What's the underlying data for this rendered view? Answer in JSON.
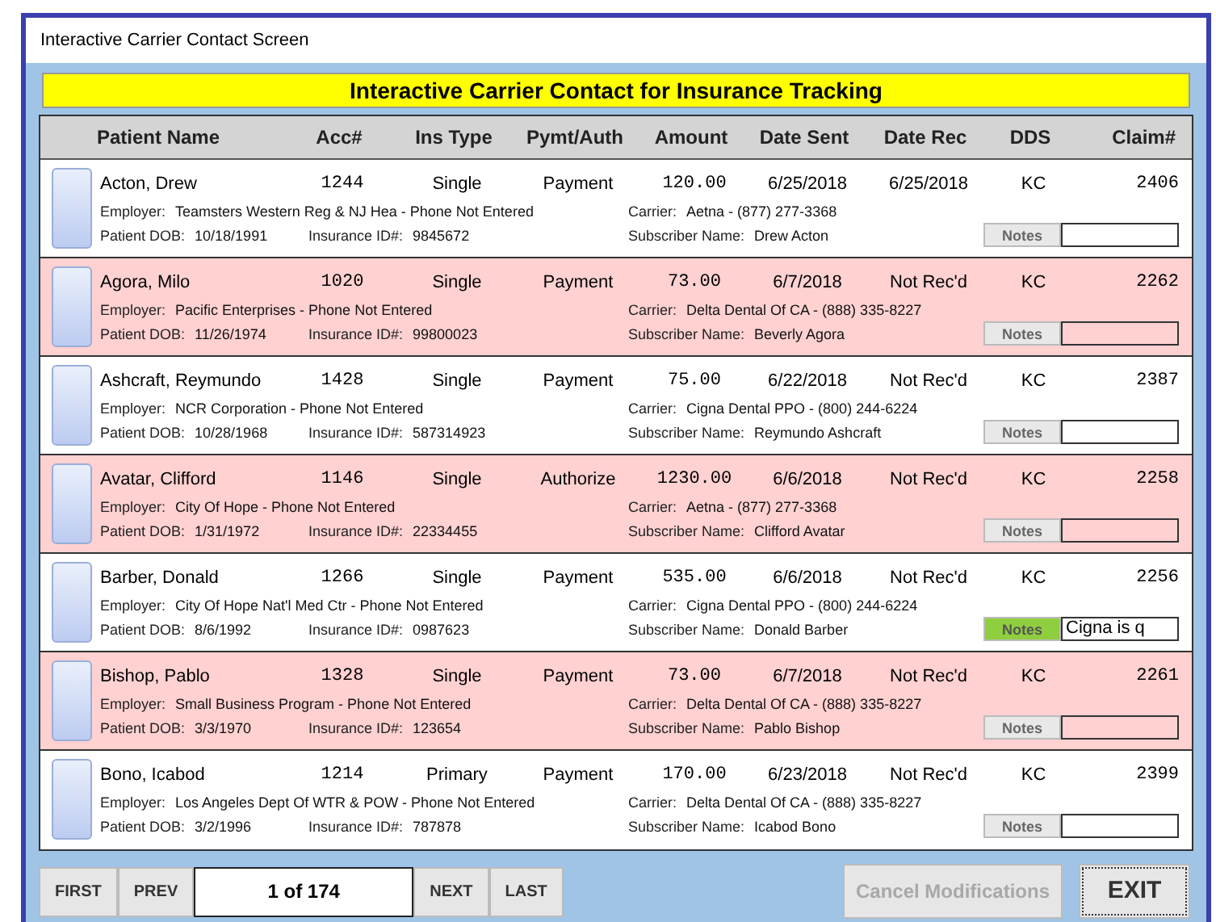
{
  "window": {
    "title": "Interactive Carrier Contact Screen"
  },
  "header": {
    "title": "Interactive Carrier Contact for Insurance Tracking"
  },
  "table": {
    "columns": [
      "Patient Name",
      "Acc#",
      "Ins Type",
      "Pymt/Auth",
      "Amount",
      "Date Sent",
      "Date Rec",
      "DDS",
      "Claim#"
    ],
    "rows": [
      {
        "flagged": false,
        "cells": [
          "Acton, Drew",
          "1244",
          "Single",
          "Payment",
          "120.00",
          "6/25/2018",
          "6/25/2018",
          "KC",
          "2406"
        ],
        "employer": {
          "label": "Employer:",
          "value": "Teamsters Western Reg & NJ Hea - Phone Not Entered"
        },
        "carrier": {
          "label": "Carrier:",
          "value": "Aetna - (877) 277-3368"
        },
        "dob": {
          "label": "Patient DOB:",
          "value": "10/18/1991"
        },
        "insurance_id": {
          "label": "Insurance ID#:",
          "value": "9845672"
        },
        "subscriber": {
          "label": "Subscriber Name:",
          "value": "Drew Acton"
        },
        "notes": {
          "label": "Notes",
          "active": false
        }
      },
      {
        "flagged": true,
        "cells": [
          "Agora, Milo",
          "1020",
          "Single",
          "Payment",
          "73.00",
          "6/7/2018",
          "Not Rec'd",
          "KC",
          "2262"
        ],
        "employer": {
          "label": "Employer:",
          "value": "Pacific Enterprises - Phone Not Entered"
        },
        "carrier": {
          "label": "Carrier:",
          "value": "Delta Dental Of CA - (888) 335-8227"
        },
        "dob": {
          "label": "Patient DOB:",
          "value": "11/26/1974"
        },
        "insurance_id": {
          "label": "Insurance ID#:",
          "value": "99800023"
        },
        "subscriber": {
          "label": "Subscriber Name:",
          "value": "Beverly Agora"
        },
        "notes": {
          "label": "Notes",
          "active": false
        }
      },
      {
        "flagged": false,
        "cells": [
          "Ashcraft, Reymundo",
          "1428",
          "Single",
          "Payment",
          "75.00",
          "6/22/2018",
          "Not Rec'd",
          "KC",
          "2387"
        ],
        "employer": {
          "label": "Employer:",
          "value": "NCR Corporation - Phone Not Entered"
        },
        "carrier": {
          "label": "Carrier:",
          "value": "Cigna Dental PPO - (800) 244-6224"
        },
        "dob": {
          "label": "Patient DOB:",
          "value": "10/28/1968"
        },
        "insurance_id": {
          "label": "Insurance ID#:",
          "value": "587314923"
        },
        "subscriber": {
          "label": "Subscriber Name:",
          "value": "Reymundo Ashcraft"
        },
        "notes": {
          "label": "Notes",
          "active": false
        }
      },
      {
        "flagged": true,
        "cells": [
          "Avatar, Clifford",
          "1146",
          "Single",
          "Authorize",
          "1230.00",
          "6/6/2018",
          "Not Rec'd",
          "KC",
          "2258"
        ],
        "employer": {
          "label": "Employer:",
          "value": "City Of Hope - Phone Not Entered"
        },
        "carrier": {
          "label": "Carrier:",
          "value": "Aetna - (877) 277-3368"
        },
        "dob": {
          "label": "Patient DOB:",
          "value": "1/31/1972"
        },
        "insurance_id": {
          "label": "Insurance ID#:",
          "value": "22334455"
        },
        "subscriber": {
          "label": "Subscriber Name:",
          "value": "Clifford Avatar"
        },
        "notes": {
          "label": "Notes",
          "active": false
        }
      },
      {
        "flagged": false,
        "cells": [
          "Barber, Donald",
          "1266",
          "Single",
          "Payment",
          "535.00",
          "6/6/2018",
          "Not Rec'd",
          "KC",
          "2256"
        ],
        "employer": {
          "label": "Employer:",
          "value": "City Of Hope Nat'l Med Ctr - Phone Not Entered"
        },
        "carrier": {
          "label": "Carrier:",
          "value": "Cigna Dental PPO - (800) 244-6224"
        },
        "dob": {
          "label": "Patient DOB:",
          "value": "8/6/1992"
        },
        "insurance_id": {
          "label": "Insurance ID#:",
          "value": "0987623"
        },
        "subscriber": {
          "label": "Subscriber Name:",
          "value": "Donald Barber"
        },
        "notes": {
          "label": "Notes",
          "active": true,
          "value": "Cigna is q"
        }
      },
      {
        "flagged": true,
        "cells": [
          "Bishop, Pablo",
          "1328",
          "Single",
          "Payment",
          "73.00",
          "6/7/2018",
          "Not Rec'd",
          "KC",
          "2261"
        ],
        "employer": {
          "label": "Employer:",
          "value": "Small Business Program - Phone Not Entered"
        },
        "carrier": {
          "label": "Carrier:",
          "value": "Delta Dental Of CA - (888) 335-8227"
        },
        "dob": {
          "label": "Patient DOB:",
          "value": "3/3/1970"
        },
        "insurance_id": {
          "label": "Insurance ID#:",
          "value": "123654"
        },
        "subscriber": {
          "label": "Subscriber Name:",
          "value": "Pablo Bishop"
        },
        "notes": {
          "label": "Notes",
          "active": false
        }
      },
      {
        "flagged": false,
        "cells": [
          "Bono, Icabod",
          "1214",
          "Primary",
          "Payment",
          "170.00",
          "6/23/2018",
          "Not Rec'd",
          "KC",
          "2399"
        ],
        "employer": {
          "label": "Employer:",
          "value": "Los Angeles Dept Of WTR & POW - Phone Not Entered"
        },
        "carrier": {
          "label": "Carrier:",
          "value": "Delta Dental Of CA - (888) 335-8227"
        },
        "dob": {
          "label": "Patient DOB:",
          "value": "3/2/1996"
        },
        "insurance_id": {
          "label": "Insurance ID#:",
          "value": "787878"
        },
        "subscriber": {
          "label": "Subscriber Name:",
          "value": "Icabod Bono"
        },
        "notes": {
          "label": "Notes",
          "active": false
        }
      }
    ]
  },
  "pager": {
    "before": [
      "FIRST",
      "PREV"
    ],
    "position": "1 of 174",
    "after": [
      "NEXT",
      "LAST"
    ]
  },
  "actions": [
    {
      "label": "Cancel Modifications",
      "disabled": true
    },
    {
      "label": "EXIT",
      "disabled": false
    }
  ]
}
